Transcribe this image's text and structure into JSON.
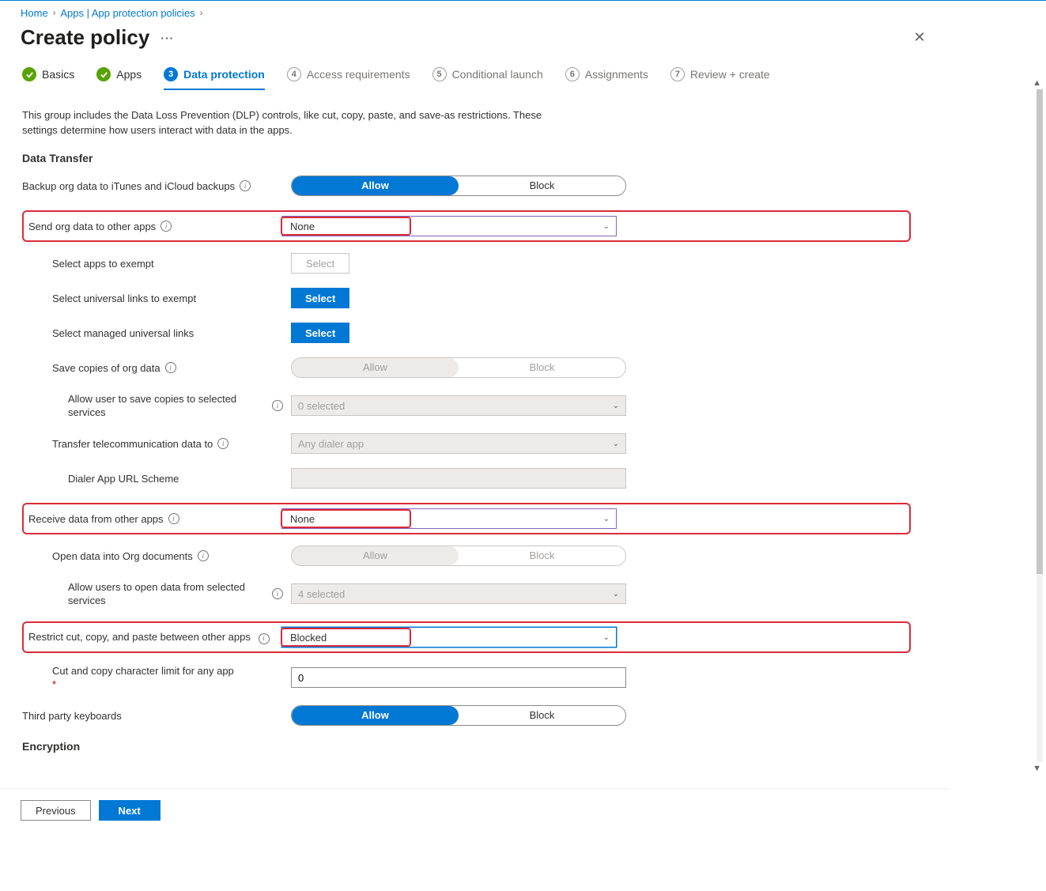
{
  "breadcrumb": {
    "home": "Home",
    "apps": "Apps | App protection policies"
  },
  "title": "Create policy",
  "wizard": {
    "s1": "Basics",
    "s2": "Apps",
    "s3": "Data protection",
    "s3_num": "3",
    "s4": "Access requirements",
    "s4_num": "4",
    "s5": "Conditional launch",
    "s5_num": "5",
    "s6": "Assignments",
    "s6_num": "6",
    "s7": "Review + create",
    "s7_num": "7"
  },
  "intro": "This group includes the Data Loss Prevention (DLP) controls, like cut, copy, paste, and save-as restrictions. These settings determine how users interact with data in the apps.",
  "section1": "Data Transfer",
  "labels": {
    "backup": "Backup org data to iTunes and iCloud backups",
    "send": "Send org data to other apps",
    "exempt_apps": "Select apps to exempt",
    "exempt_links": "Select universal links to exempt",
    "managed_links": "Select managed universal links",
    "save_copies": "Save copies of org data",
    "save_services": "Allow user to save copies to selected services",
    "transfer_tele": "Transfer telecommunication data to",
    "dialer": "Dialer App URL Scheme",
    "receive": "Receive data from other apps",
    "open_org": "Open data into Org documents",
    "open_services": "Allow users to open data from selected services",
    "restrict_ccp": "Restrict cut, copy, and paste between other apps",
    "cut_limit": "Cut and copy character limit for any app",
    "third_party": "Third party keyboards"
  },
  "values": {
    "seg_allow": "Allow",
    "seg_block": "Block",
    "none": "None",
    "sel_0": "0 selected",
    "sel_4": "4 selected",
    "any_dialer": "Any dialer app",
    "blocked": "Blocked",
    "zero": "0",
    "select_btn": "Select",
    "required_star": "*"
  },
  "section2": "Encryption",
  "footer": {
    "prev": "Previous",
    "next": "Next"
  },
  "info_glyph": "i"
}
